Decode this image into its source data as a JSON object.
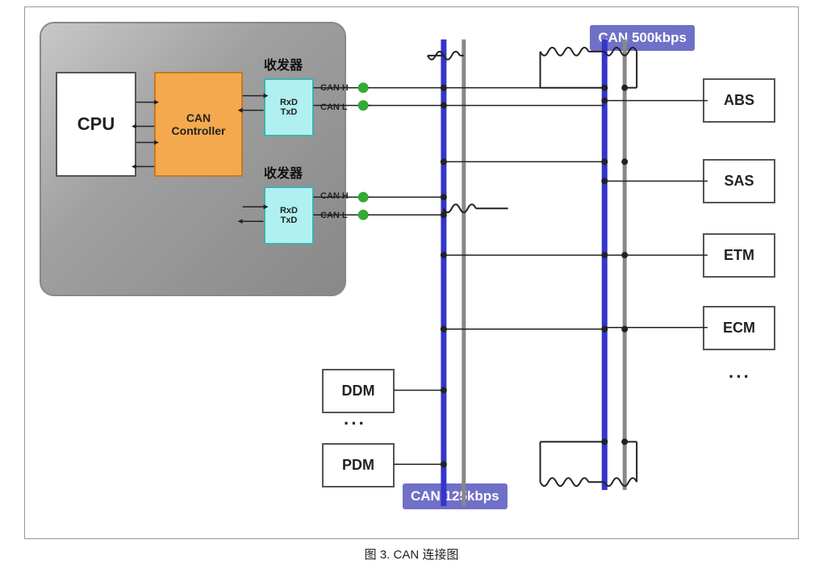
{
  "diagram": {
    "title": "图 3.   CAN 连接图",
    "ecu": {
      "cpu_label": "CPU",
      "can_controller_label": "CAN\nController",
      "transceiver1_label": "收发器",
      "transceiver2_label": "收发器",
      "rxd_txd": "RxD\nTxD",
      "canh": "CAN H",
      "canl": "CAN L"
    },
    "nodes_right": [
      "ABS",
      "SAS",
      "ETM",
      "ECM"
    ],
    "nodes_bottom": [
      "DDM",
      "PDM"
    ],
    "can_badge_right": "CAN\n500kbps",
    "can_badge_bottom": "CAN\n125kbps",
    "dots": "···"
  }
}
